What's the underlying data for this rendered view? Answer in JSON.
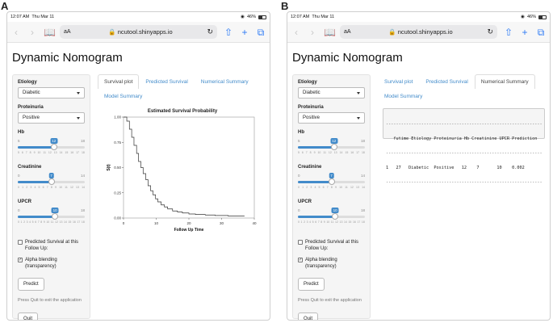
{
  "figure": {
    "label_a": "A",
    "label_b": "B"
  },
  "status": {
    "time": "12:07 AM",
    "date": "Thu Mar 11",
    "battery": "46%"
  },
  "browser": {
    "text_size": "aA",
    "url": "ncutool.shinyapps.io"
  },
  "icons": {
    "back": "chevron-left-icon",
    "forward": "chevron-right-icon",
    "bookmarks": "book-icon",
    "lock": "lock-icon",
    "reload": "reload-icon",
    "share": "share-icon",
    "new_tab": "plus-icon",
    "tabs": "tabs-icon"
  },
  "app": {
    "title": "Dynamic Nomogram"
  },
  "sidebar": {
    "etiology_label": "Etiology",
    "etiology_value": "Diabetic",
    "proteinuria_label": "Proteinuria",
    "proteinuria_value": "Positive",
    "hb": {
      "label": "Hb",
      "min": "5",
      "max": "18",
      "value": "12",
      "level": 0.54,
      "ticks": [
        "5",
        "6",
        "7",
        "8",
        "9",
        "10",
        "11",
        "12",
        "13",
        "14",
        "15",
        "16",
        "17",
        "18"
      ]
    },
    "creatinine": {
      "label": "Creatinine",
      "min": "0",
      "max": "14",
      "value": "7",
      "level": 0.5,
      "ticks": [
        "0",
        "1",
        "2",
        "3",
        "4",
        "5",
        "6",
        "7",
        "8",
        "9",
        "10",
        "11",
        "12",
        "13",
        "14"
      ]
    },
    "upcr": {
      "label": "UPCR",
      "min": "0",
      "max": "18",
      "value": "10",
      "level": 0.556,
      "ticks": [
        "0",
        "1",
        "2",
        "3",
        "4",
        "5",
        "6",
        "7",
        "8",
        "9",
        "10",
        "11",
        "12",
        "13",
        "14",
        "15",
        "16",
        "17",
        "18"
      ]
    },
    "predicted_survival_check": "Predicted Survival at this Follow Up:",
    "alpha_check": "Alpha blending (transparency)",
    "check_mark": "✓",
    "predict_button": "Predict",
    "quit_note": "Press Quit to exit the application",
    "quit_button": "Quit"
  },
  "tabs": {
    "survival_plot": "Survival plot",
    "predicted_survival": "Predicted Survival",
    "numerical_summary": "Numerical Summary",
    "model_summary": "Model Summary"
  },
  "chart_data": {
    "type": "line",
    "title": "Estimated Survival Probability",
    "xlabel": "Follow Up Time",
    "ylabel": "S(t)",
    "xlim": [
      0,
      40
    ],
    "ylim": [
      0,
      1
    ],
    "x_ticks": [
      "0",
      "10",
      "20",
      "30",
      "40"
    ],
    "y_ticks": [
      "0.00",
      "0.25",
      "0.50",
      "0.75",
      "1.00"
    ],
    "series": [
      {
        "x": [
          0,
          1,
          1.8,
          2.5,
          3.2,
          4,
          4.6,
          5.3,
          6,
          6.8,
          7.5,
          8.3,
          9,
          9.8,
          10.5,
          11.5,
          12.5,
          13.5,
          15,
          16.5,
          18,
          20,
          22,
          25,
          28,
          32,
          37
        ],
        "y": [
          1.0,
          0.96,
          0.88,
          0.8,
          0.72,
          0.64,
          0.56,
          0.5,
          0.44,
          0.38,
          0.32,
          0.27,
          0.23,
          0.19,
          0.16,
          0.13,
          0.11,
          0.09,
          0.07,
          0.06,
          0.05,
          0.04,
          0.035,
          0.03,
          0.025,
          0.02,
          0.02
        ]
      }
    ]
  },
  "summary": {
    "dashes": "--------------------------------------------------------------------------",
    "header": "   futime Etiology Proteinuria Hb Creatinine UPCR Prediction",
    "row": "1   27   Diabetic  Positive   12    7       10    0.002"
  }
}
